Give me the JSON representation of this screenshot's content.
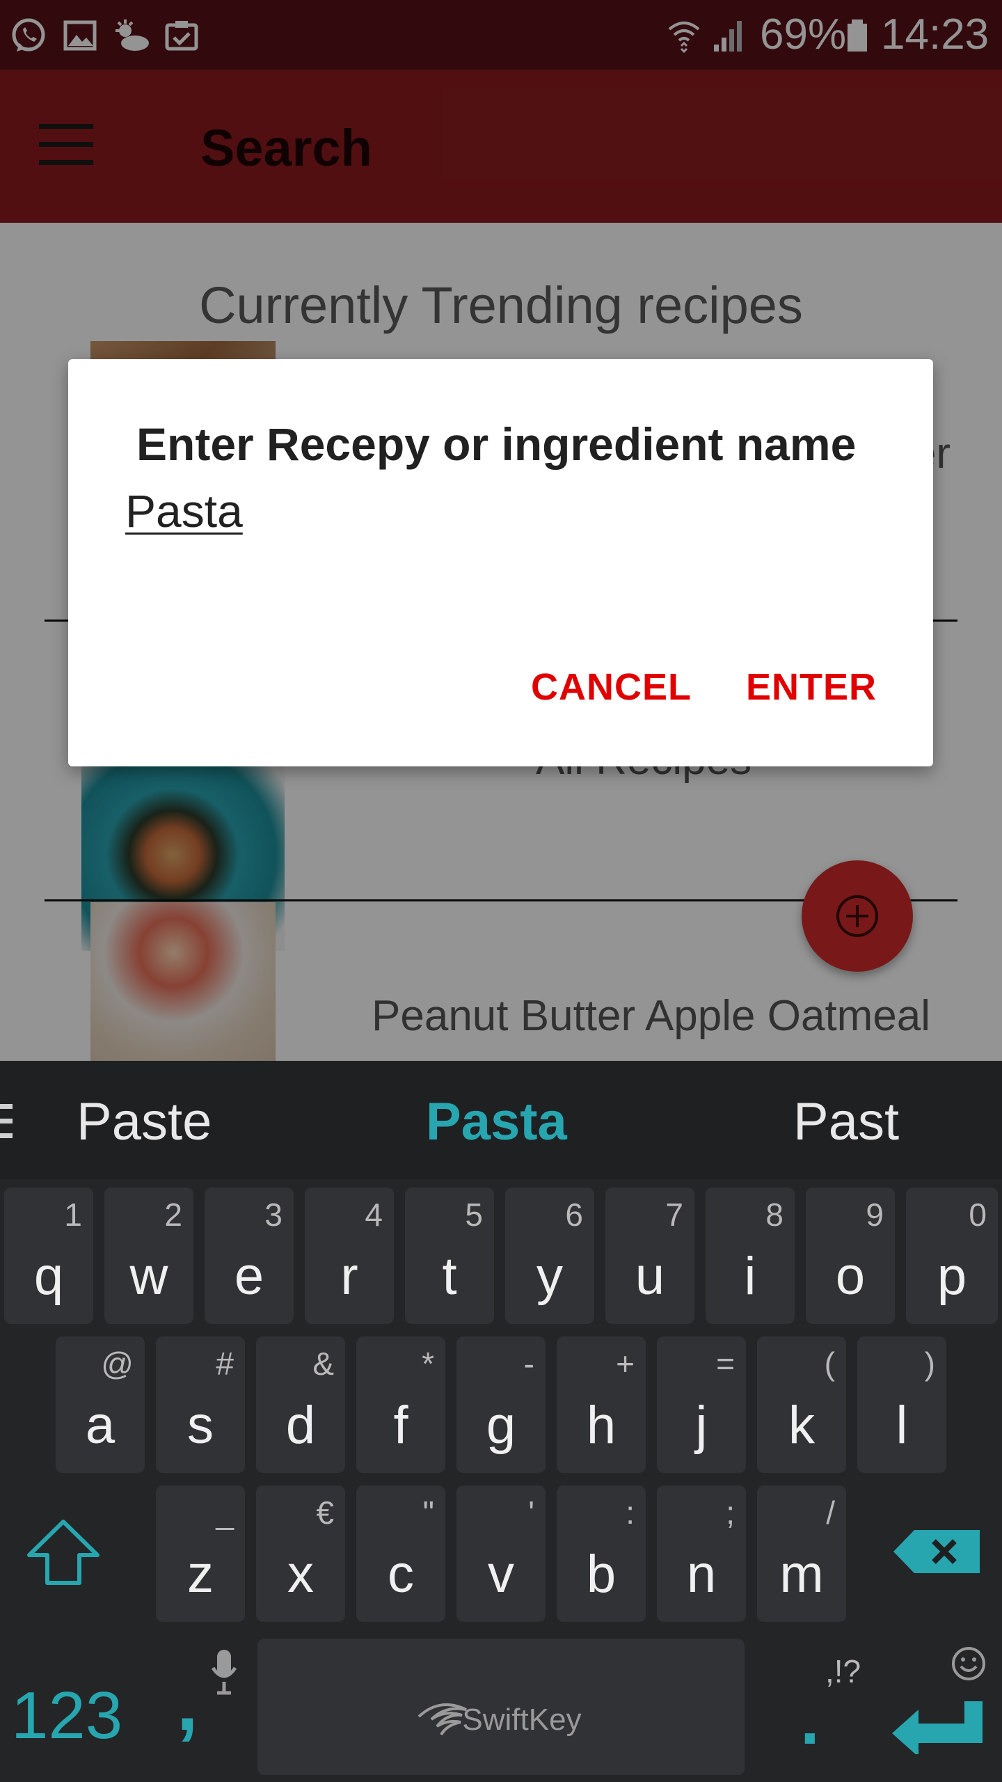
{
  "status_bar": {
    "battery_percent": "69%",
    "time": "14:23",
    "icons": [
      "whatsapp-icon",
      "gallery-icon",
      "weather-icon",
      "clipboard-check-icon",
      "wifi-icon",
      "signal-icon",
      "battery-icon"
    ]
  },
  "toolbar": {
    "title": "Search",
    "menu_icon": "hamburger-menu-icon",
    "background_color": "#8c1b1e"
  },
  "content": {
    "section_title": "Currently Trending recipes",
    "rows": [
      {
        "title_fragment": "er"
      },
      {
        "title_fragment": "All Recipes"
      },
      {
        "title_fragment": "Peanut Butter Apple Oatmeal"
      }
    ],
    "fab_icon": "add-circle-icon"
  },
  "dialog": {
    "title": "Enter Recepy or ingredient name",
    "input_value": "Pasta",
    "cancel_label": "CANCEL",
    "enter_label": "ENTER",
    "accent_color": "#e10000"
  },
  "keyboard": {
    "suggestions": [
      "Paste",
      "Pasta",
      "Past"
    ],
    "row1": [
      {
        "key": "q",
        "hint": "1"
      },
      {
        "key": "w",
        "hint": "2"
      },
      {
        "key": "e",
        "hint": "3"
      },
      {
        "key": "r",
        "hint": "4"
      },
      {
        "key": "t",
        "hint": "5"
      },
      {
        "key": "y",
        "hint": "6"
      },
      {
        "key": "u",
        "hint": "7"
      },
      {
        "key": "i",
        "hint": "8"
      },
      {
        "key": "o",
        "hint": "9"
      },
      {
        "key": "p",
        "hint": "0"
      }
    ],
    "row2": [
      {
        "key": "a",
        "hint": "@"
      },
      {
        "key": "s",
        "hint": "#"
      },
      {
        "key": "d",
        "hint": "&"
      },
      {
        "key": "f",
        "hint": "*"
      },
      {
        "key": "g",
        "hint": "-"
      },
      {
        "key": "h",
        "hint": "+"
      },
      {
        "key": "j",
        "hint": "="
      },
      {
        "key": "k",
        "hint": "("
      },
      {
        "key": "l",
        "hint": ")"
      }
    ],
    "row3": [
      {
        "key": "z",
        "hint": "_"
      },
      {
        "key": "x",
        "hint": "€"
      },
      {
        "key": "c",
        "hint": "\""
      },
      {
        "key": "v",
        "hint": "'"
      },
      {
        "key": "b",
        "hint": ":"
      },
      {
        "key": "n",
        "hint": ";"
      },
      {
        "key": "m",
        "hint": "/"
      }
    ],
    "numbers_label": "123",
    "comma_label": ",",
    "period_label": ".",
    "period_hint": ",!?",
    "space_brand": "SwiftKey",
    "accent_color": "#27a6b0"
  }
}
